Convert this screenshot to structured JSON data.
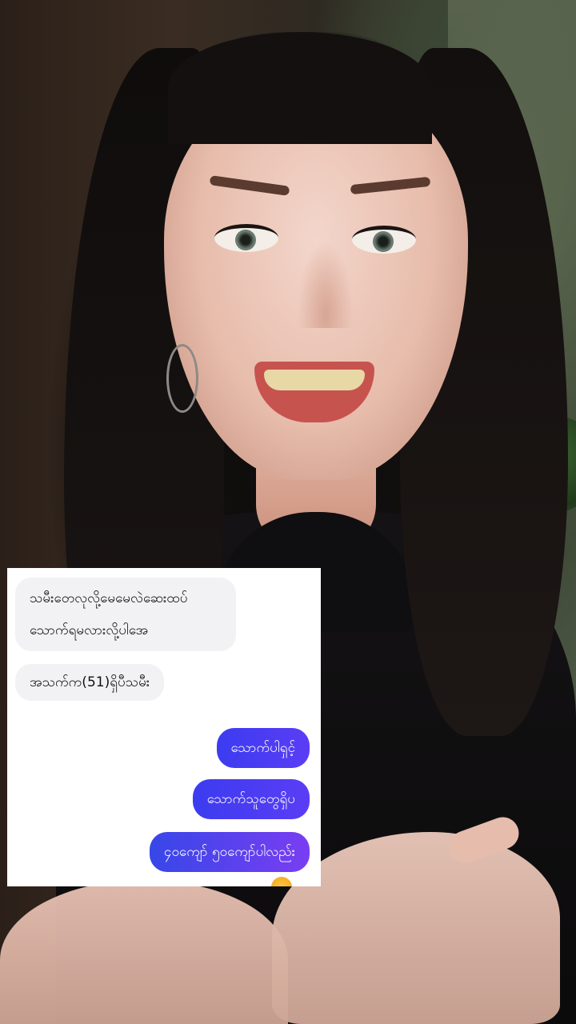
{
  "chat": {
    "received": [
      {
        "text": "သမီးတေလုလို့မေမေလဲဆေးထပ် သောက်ရမလားလို့ပါအေ"
      },
      {
        "text": "အသက်က(51)ရှိပီသမီး"
      }
    ],
    "sent": [
      {
        "text": "သောက်ပါရှင့်"
      },
      {
        "text": "သောက်သူတွေရှိပ"
      },
      {
        "text": "၄၀ကျော် ၅၀ကျော်ပါလည်း"
      }
    ],
    "colors": {
      "received_bubble": "#f2f2f4",
      "sent_bubble_start": "#3c3cf0",
      "sent_bubble_end": "#7a3df2"
    }
  }
}
